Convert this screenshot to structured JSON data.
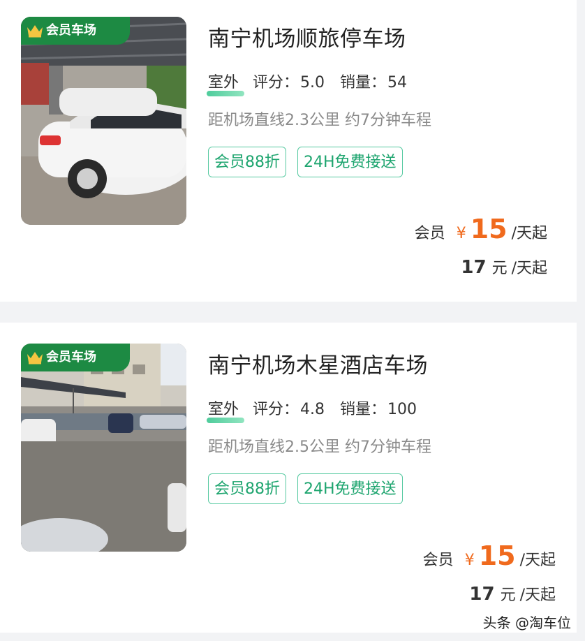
{
  "listings": [
    {
      "badge": "会员车场",
      "title": "南宁机场顺旅停车场",
      "type": "室外",
      "rating_label": "评分：",
      "rating": "5.0",
      "sales_label": "销量：",
      "sales": "54",
      "distance": "距机场直线2.3公里 约7分钟车程",
      "tags": [
        "会员88折",
        "24H免费接送"
      ],
      "member_label": "会员",
      "currency": "¥",
      "member_price": "15",
      "unit": "/天起",
      "regular_price": "17",
      "regular_currency": "元"
    },
    {
      "badge": "会员车场",
      "title": "南宁机场木星酒店车场",
      "type": "室外",
      "rating_label": "评分：",
      "rating": "4.8",
      "sales_label": "销量：",
      "sales": "100",
      "distance": "距机场直线2.5公里 约7分钟车程",
      "tags": [
        "会员88折",
        "24H免费接送"
      ],
      "member_label": "会员",
      "currency": "¥",
      "member_price": "15",
      "unit": "/天起",
      "regular_price": "17",
      "regular_currency": "元"
    }
  ],
  "watermark": "头条 @淘车位",
  "colors": {
    "badge_green": "#1d8a43",
    "tag_green": "#1ea56f",
    "price_orange": "#f06a1d",
    "background": "#f2f3f5"
  },
  "icons": {
    "badge": "crown-icon"
  }
}
